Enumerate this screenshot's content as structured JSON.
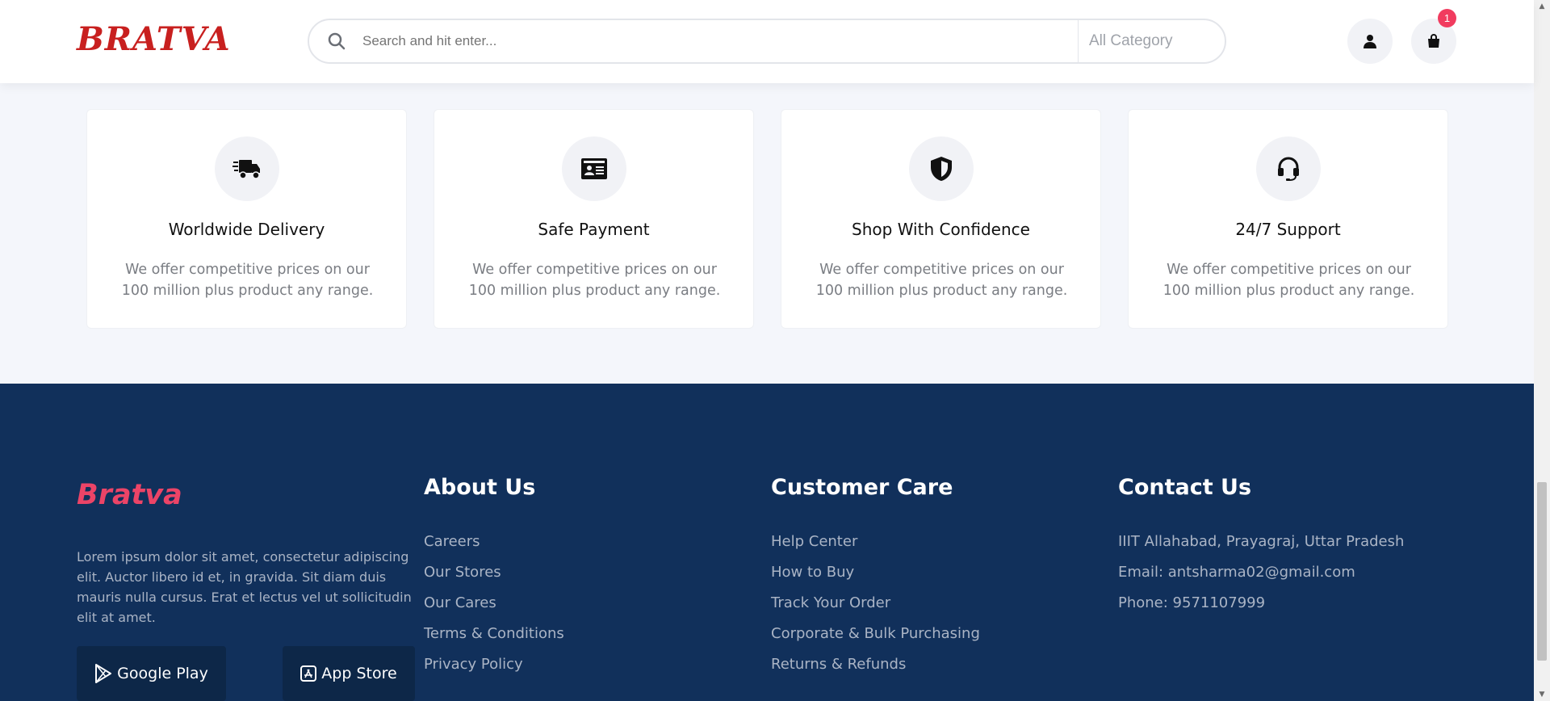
{
  "header": {
    "logo": "BRATVA",
    "search_placeholder": "Search and hit enter...",
    "category": "All Category",
    "cart_count": "1"
  },
  "features": [
    {
      "title": "Worldwide Delivery",
      "desc": "We offer competitive prices on our 100 million plus product any range.",
      "icon": "delivery-truck-icon"
    },
    {
      "title": "Safe Payment",
      "desc": "We offer competitive prices on our 100 million plus product any range.",
      "icon": "id-card-icon"
    },
    {
      "title": "Shop With Confidence",
      "desc": "We offer competitive prices on our 100 million plus product any range.",
      "icon": "shield-icon"
    },
    {
      "title": "24/7 Support",
      "desc": "We offer competitive prices on our 100 million plus product any range.",
      "icon": "headset-icon"
    }
  ],
  "footer": {
    "logo": "Bratva",
    "about_text": "Lorem ipsum dolor sit amet, consectetur adipiscing elit. Auctor libero id et, in gravida. Sit diam duis mauris nulla cursus. Erat et lectus vel ut sollicitudin elit at amet.",
    "google_play": "Google Play",
    "app_store": "App Store",
    "about": {
      "heading": "About Us",
      "links": [
        "Careers",
        "Our Stores",
        "Our Cares",
        "Terms & Conditions",
        "Privacy Policy"
      ]
    },
    "care": {
      "heading": "Customer Care",
      "links": [
        "Help Center",
        "How to Buy",
        "Track Your Order",
        "Corporate & Bulk Purchasing",
        "Returns & Refunds"
      ]
    },
    "contact": {
      "heading": "Contact Us",
      "lines": [
        "IIIT Allahabad, Prayagraj, Uttar Pradesh",
        "Email: antsharma02@gmail.com",
        "Phone: 9571107999"
      ]
    }
  },
  "colors": {
    "brand_red": "#c8201f",
    "footer_bg": "#11305b",
    "footer_logo": "#ec4467",
    "badge": "#f13c5f"
  }
}
